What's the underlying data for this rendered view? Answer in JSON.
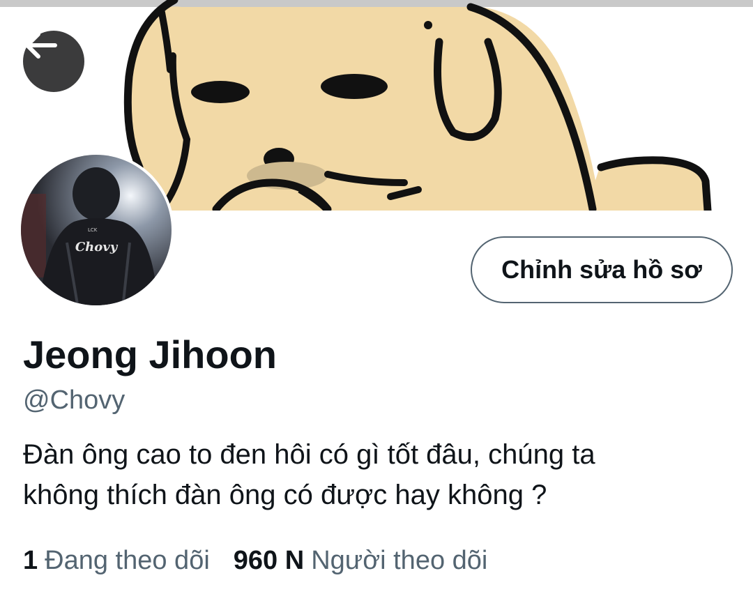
{
  "header": {
    "back_icon": "arrow-left-icon",
    "banner_description_icon": "cartoon-dog-banner"
  },
  "profile": {
    "avatar_icon": "avatar-photo",
    "avatar_jersey_text": "Chovy",
    "edit_button_label": "Chỉnh sửa hồ sơ",
    "display_name": "Jeong Jihoon",
    "handle": "@Chovy",
    "bio_lines": [
      "Đàn ông cao to đen hôi có gì tốt đâu, chúng ta",
      "không thích đàn ông có được hay không ?"
    ]
  },
  "stats": {
    "following_count": "1",
    "following_label": "Đang theo dõi",
    "followers_count": "960 N",
    "followers_label": "Người theo dõi"
  },
  "colors": {
    "text_primary": "#0f1419",
    "text_secondary": "#536471",
    "button_border": "#536471",
    "back_button_bg": "#3b3b3c",
    "banner_dog_fill": "#f2d9a6"
  }
}
